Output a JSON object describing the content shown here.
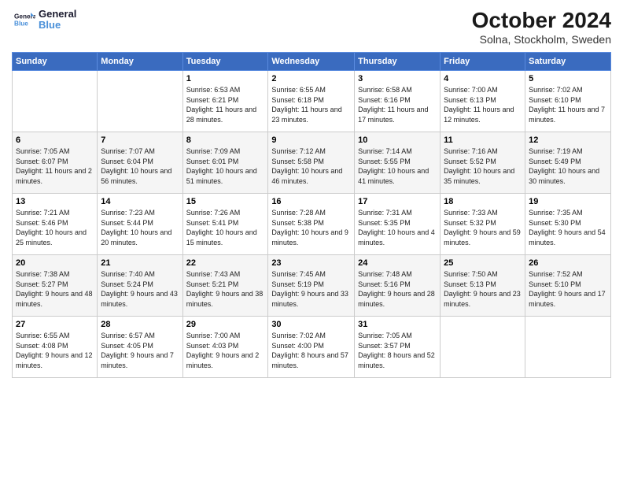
{
  "header": {
    "logo_line1": "General",
    "logo_line2": "Blue",
    "title": "October 2024",
    "location": "Solna, Stockholm, Sweden"
  },
  "weekdays": [
    "Sunday",
    "Monday",
    "Tuesday",
    "Wednesday",
    "Thursday",
    "Friday",
    "Saturday"
  ],
  "weeks": [
    [
      {
        "day": "",
        "info": ""
      },
      {
        "day": "",
        "info": ""
      },
      {
        "day": "1",
        "info": "Sunrise: 6:53 AM\nSunset: 6:21 PM\nDaylight: 11 hours and 28 minutes."
      },
      {
        "day": "2",
        "info": "Sunrise: 6:55 AM\nSunset: 6:18 PM\nDaylight: 11 hours and 23 minutes."
      },
      {
        "day": "3",
        "info": "Sunrise: 6:58 AM\nSunset: 6:16 PM\nDaylight: 11 hours and 17 minutes."
      },
      {
        "day": "4",
        "info": "Sunrise: 7:00 AM\nSunset: 6:13 PM\nDaylight: 11 hours and 12 minutes."
      },
      {
        "day": "5",
        "info": "Sunrise: 7:02 AM\nSunset: 6:10 PM\nDaylight: 11 hours and 7 minutes."
      }
    ],
    [
      {
        "day": "6",
        "info": "Sunrise: 7:05 AM\nSunset: 6:07 PM\nDaylight: 11 hours and 2 minutes."
      },
      {
        "day": "7",
        "info": "Sunrise: 7:07 AM\nSunset: 6:04 PM\nDaylight: 10 hours and 56 minutes."
      },
      {
        "day": "8",
        "info": "Sunrise: 7:09 AM\nSunset: 6:01 PM\nDaylight: 10 hours and 51 minutes."
      },
      {
        "day": "9",
        "info": "Sunrise: 7:12 AM\nSunset: 5:58 PM\nDaylight: 10 hours and 46 minutes."
      },
      {
        "day": "10",
        "info": "Sunrise: 7:14 AM\nSunset: 5:55 PM\nDaylight: 10 hours and 41 minutes."
      },
      {
        "day": "11",
        "info": "Sunrise: 7:16 AM\nSunset: 5:52 PM\nDaylight: 10 hours and 35 minutes."
      },
      {
        "day": "12",
        "info": "Sunrise: 7:19 AM\nSunset: 5:49 PM\nDaylight: 10 hours and 30 minutes."
      }
    ],
    [
      {
        "day": "13",
        "info": "Sunrise: 7:21 AM\nSunset: 5:46 PM\nDaylight: 10 hours and 25 minutes."
      },
      {
        "day": "14",
        "info": "Sunrise: 7:23 AM\nSunset: 5:44 PM\nDaylight: 10 hours and 20 minutes."
      },
      {
        "day": "15",
        "info": "Sunrise: 7:26 AM\nSunset: 5:41 PM\nDaylight: 10 hours and 15 minutes."
      },
      {
        "day": "16",
        "info": "Sunrise: 7:28 AM\nSunset: 5:38 PM\nDaylight: 10 hours and 9 minutes."
      },
      {
        "day": "17",
        "info": "Sunrise: 7:31 AM\nSunset: 5:35 PM\nDaylight: 10 hours and 4 minutes."
      },
      {
        "day": "18",
        "info": "Sunrise: 7:33 AM\nSunset: 5:32 PM\nDaylight: 9 hours and 59 minutes."
      },
      {
        "day": "19",
        "info": "Sunrise: 7:35 AM\nSunset: 5:30 PM\nDaylight: 9 hours and 54 minutes."
      }
    ],
    [
      {
        "day": "20",
        "info": "Sunrise: 7:38 AM\nSunset: 5:27 PM\nDaylight: 9 hours and 48 minutes."
      },
      {
        "day": "21",
        "info": "Sunrise: 7:40 AM\nSunset: 5:24 PM\nDaylight: 9 hours and 43 minutes."
      },
      {
        "day": "22",
        "info": "Sunrise: 7:43 AM\nSunset: 5:21 PM\nDaylight: 9 hours and 38 minutes."
      },
      {
        "day": "23",
        "info": "Sunrise: 7:45 AM\nSunset: 5:19 PM\nDaylight: 9 hours and 33 minutes."
      },
      {
        "day": "24",
        "info": "Sunrise: 7:48 AM\nSunset: 5:16 PM\nDaylight: 9 hours and 28 minutes."
      },
      {
        "day": "25",
        "info": "Sunrise: 7:50 AM\nSunset: 5:13 PM\nDaylight: 9 hours and 23 minutes."
      },
      {
        "day": "26",
        "info": "Sunrise: 7:52 AM\nSunset: 5:10 PM\nDaylight: 9 hours and 17 minutes."
      }
    ],
    [
      {
        "day": "27",
        "info": "Sunrise: 6:55 AM\nSunset: 4:08 PM\nDaylight: 9 hours and 12 minutes."
      },
      {
        "day": "28",
        "info": "Sunrise: 6:57 AM\nSunset: 4:05 PM\nDaylight: 9 hours and 7 minutes."
      },
      {
        "day": "29",
        "info": "Sunrise: 7:00 AM\nSunset: 4:03 PM\nDaylight: 9 hours and 2 minutes."
      },
      {
        "day": "30",
        "info": "Sunrise: 7:02 AM\nSunset: 4:00 PM\nDaylight: 8 hours and 57 minutes."
      },
      {
        "day": "31",
        "info": "Sunrise: 7:05 AM\nSunset: 3:57 PM\nDaylight: 8 hours and 52 minutes."
      },
      {
        "day": "",
        "info": ""
      },
      {
        "day": "",
        "info": ""
      }
    ]
  ]
}
